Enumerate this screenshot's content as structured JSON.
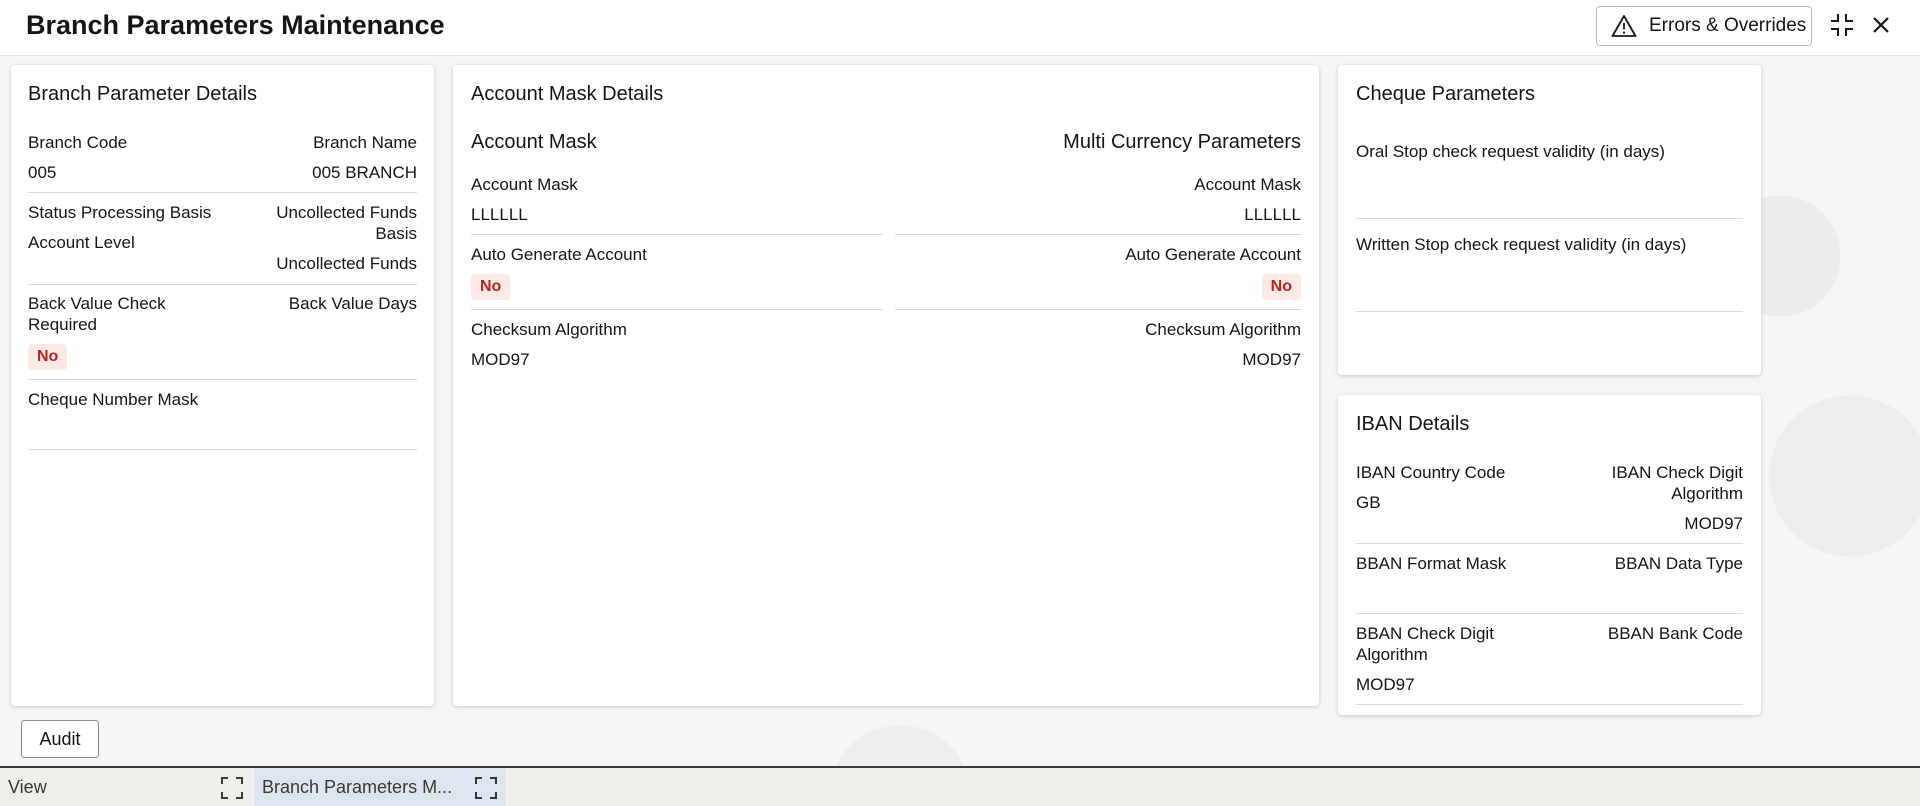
{
  "header": {
    "title": "Branch Parameters Maintenance",
    "errors_button": "Errors & Overrides",
    "icons": [
      "warning-icon",
      "minimize-icon",
      "close-icon"
    ]
  },
  "branch_card": {
    "title": "Branch Parameter Details",
    "branch_code_label": "Branch Code",
    "branch_code_value": "005",
    "branch_name_label": "Branch Name",
    "branch_name_value": "005 BRANCH",
    "status_basis_label": "Status Processing Basis",
    "status_basis_value": "Account Level",
    "uncollected_label_1": "Uncollected Funds",
    "uncollected_label_2": "Basis",
    "uncollected_value": "Uncollected Funds",
    "back_value_check_label_1": "Back Value Check",
    "back_value_check_label_2": "Required",
    "back_value_check_value": "No",
    "back_value_days_label": "Back Value Days",
    "cheque_mask_label": "Cheque Number Mask"
  },
  "account_mask_card": {
    "title": "Account Mask Details",
    "left_heading": "Account Mask",
    "right_heading": "Multi Currency Parameters",
    "account_mask_label": "Account Mask",
    "account_mask_value": "LLLLLL",
    "mc_account_mask_label": "Account Mask",
    "mc_account_mask_value": "LLLLLL",
    "auto_gen_label": "Auto Generate Account",
    "auto_gen_value": "No",
    "mc_auto_gen_label": "Auto Generate Account",
    "mc_auto_gen_value": "No",
    "checksum_label": "Checksum Algorithm",
    "checksum_value": "MOD97",
    "mc_checksum_label": "Checksum Algorithm",
    "mc_checksum_value": "MOD97"
  },
  "cheque_card": {
    "title": "Cheque Parameters",
    "oral_stop_label": "Oral Stop check request validity (in days)",
    "written_stop_label": "Written Stop check request validity (in days)"
  },
  "iban_card": {
    "title": "IBAN Details",
    "country_code_label": "IBAN Country Code",
    "country_code_value": "GB",
    "check_digit_label_1": "IBAN Check Digit",
    "check_digit_label_2": "Algorithm",
    "check_digit_value": "MOD97",
    "bban_format_label": "BBAN Format Mask",
    "bban_data_type_label": "BBAN Data Type",
    "bban_check_label_1": "BBAN Check Digit",
    "bban_check_label_2": "Algorithm",
    "bban_check_value": "MOD97",
    "bban_bank_code_label": "BBAN Bank Code"
  },
  "footer": {
    "audit_button": "Audit"
  },
  "taskbar": {
    "tabs": [
      {
        "label": "View",
        "active": false
      },
      {
        "label": "Branch Parameters M...",
        "active": true
      }
    ]
  },
  "colors": {
    "badge_text": "#b8261b",
    "badge_bg": "#fbe9e5",
    "active_tab": "#dde6ee"
  }
}
